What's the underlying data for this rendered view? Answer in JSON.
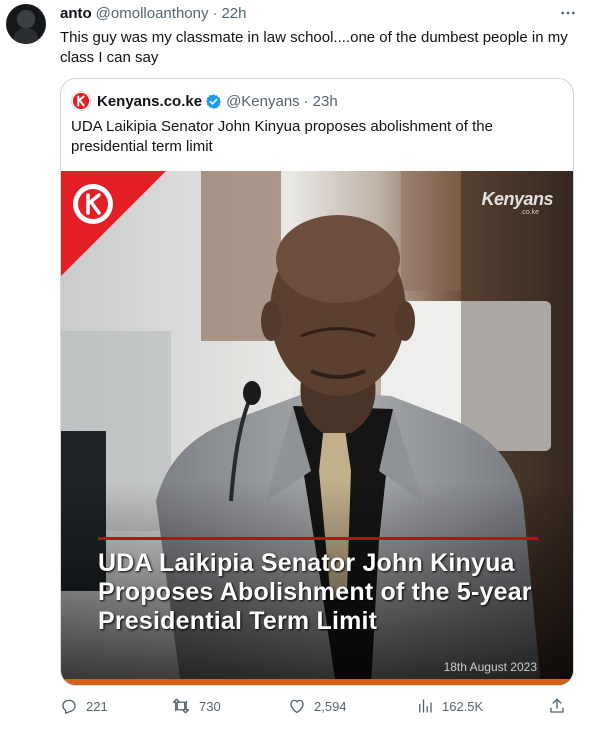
{
  "tweet": {
    "author_name": "anto",
    "author_handle": "@omolloanthony",
    "separator": "·",
    "time": "22h",
    "text": "This guy was my classmate in law school....one of the dumbest people in my class I can say"
  },
  "quoted_tweet": {
    "author_name": "Kenyans.co.ke",
    "author_handle": "@Kenyans",
    "separator": "·",
    "time": "23h",
    "text": "UDA Laikipia Senator John Kinyua proposes abolishment of the presidential term limit",
    "media": {
      "caption": "UDA Laikipia Senator John Kinyua Proposes Abolishment of the 5-year Presidential Term Limit",
      "brand": "Kenyans",
      "brand_sub": ".co.ke",
      "date": "18th August 2023"
    }
  },
  "actions": {
    "replies": "221",
    "retweets": "730",
    "likes": "2,594",
    "views": "162.5K"
  },
  "icons": [
    "more-icon",
    "verified-icon",
    "reply-icon",
    "retweet-icon",
    "like-icon",
    "views-icon",
    "share-icon"
  ],
  "colors": {
    "verified": "#1d9bf0",
    "brand_red": "#e31e24",
    "caption_bar": "#b3121b"
  }
}
